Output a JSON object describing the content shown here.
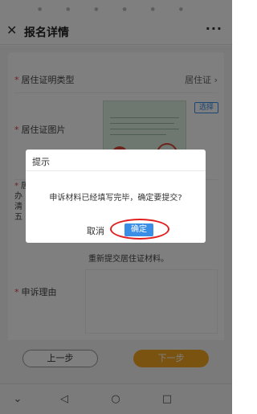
{
  "window": {
    "title": "报名详情",
    "close_icon": "close-icon",
    "more_icon": "more-dots-icon"
  },
  "form": {
    "residence_type_label": "居住证明类型",
    "residence_type_value": "居住证",
    "residence_image_label": "居住证图片",
    "reselect_label": "选择",
    "obscured_label": "居\n办\n清\n五",
    "notice_text": "重新提交居住证材料。",
    "reason_label": "申诉理由",
    "required_mark": "*"
  },
  "footer": {
    "prev_label": "上一步",
    "next_label": "下一步"
  },
  "dialog": {
    "title": "提示",
    "message": "申诉材料已经填写完毕，确定要提交?",
    "cancel_label": "取消",
    "confirm_label": "确定"
  },
  "colors": {
    "accent_blue": "#3a8ee6",
    "next_button": "#f5a623",
    "highlight_ring": "#e02020",
    "required": "#e04040"
  },
  "nav": {
    "back_icon": "back-triangle-icon",
    "home_icon": "home-circle-icon",
    "recents_icon": "recents-square-icon",
    "down_icon": "chevron-down-icon"
  }
}
